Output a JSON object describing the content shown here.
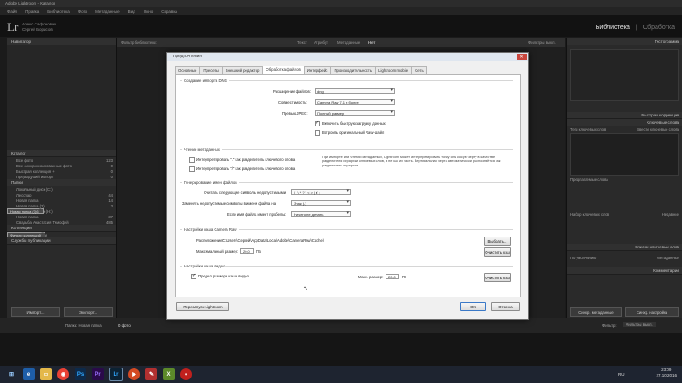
{
  "window": {
    "title": "Adobe Lightroom - Каталог"
  },
  "menu": [
    "Файл",
    "Правка",
    "Библиотека",
    "Фото",
    "Метаданные",
    "Вид",
    "Окно",
    "Справка"
  ],
  "identity": {
    "logo": "Lr",
    "line1": "Алекс Сафонович",
    "line2": "Сергей Борисов"
  },
  "modules": {
    "library": "Библиотека",
    "sep": "|",
    "develop": "Обработка"
  },
  "left_panel": {
    "navigator": "Навигатор",
    "catalog": "Каталог",
    "catalog_items": [
      {
        "label": "Все фото",
        "count": "123"
      },
      {
        "label": "Все синхронизированные фото",
        "count": "0"
      },
      {
        "label": "Быстрая коллекция +",
        "count": "0"
      },
      {
        "label": "Предыдущий импорт",
        "count": "0"
      }
    ],
    "folders": "Папки",
    "folder_items": [
      {
        "label": "Локальный диск (C:)",
        "count": ""
      },
      {
        "label": "Лесопар",
        "count": "44"
      },
      {
        "label": "Новая папка",
        "count": "14"
      },
      {
        "label": "Новая папка (2)",
        "count": "3"
      },
      {
        "label": "Новая папка (3)",
        "count": "6"
      },
      {
        "label": "Локальный диск (H:)",
        "count": ""
      },
      {
        "label": "Новая папка",
        "count": "37"
      },
      {
        "label": "Свадьба Анастасия Тимофей",
        "count": "485"
      }
    ],
    "collections": "Коллекции",
    "collection_items": [
      {
        "label": "Фильтр коллекций"
      },
      {
        "label": "Смарт-коллекции"
      }
    ],
    "publish": "Службы публикации",
    "import_btn": "Импорт...",
    "export_btn": "Экспорт..."
  },
  "right_panel": {
    "histogram": "Гистограмма",
    "quick_develop": "Быстрая коррекция",
    "keywording": "Ключевые слова",
    "keyword_tags": "Теги ключевых слов",
    "keyword_placeholder": "Ввести ключевые слова",
    "keyword_suggestions": "Предлагаемые слова",
    "keyword_set": "Набор ключевых слов",
    "keyword_set_value": "Недавние",
    "keyword_list": "Список ключевых слов",
    "metadata": "Метаданные",
    "metadata_preset": "По умолчанию",
    "comments": "Комментарии",
    "sync": "Синхр. метаданные",
    "sync_settings": "Синхр. настройки"
  },
  "filter_bar": {
    "label": "Фильтр библиотеки:",
    "text": "Текст",
    "attribute": "Атрибут",
    "metadata": "Метаданные",
    "none": "Нет",
    "off": "Фильтры выкл."
  },
  "filmstrip": {
    "path": "Папка: Новая папка",
    "count": "0 фото",
    "filter": "Фильтр:",
    "filter_value": "Фильтры выкл."
  },
  "dialog": {
    "title": "Предпочтения",
    "close": "✕",
    "tabs": [
      "Основные",
      "Пресеты",
      "Внешний редактор",
      "Обработка файлов",
      "Интерфейс",
      "Производительность",
      "Lightroom mobile",
      "Сеть"
    ],
    "active_tab": 3,
    "import_dng": {
      "title": "Создание импорта DNG",
      "ext_label": "Расширение файлов:",
      "ext_value": "dng",
      "compat_label": "Совместимость:",
      "compat_value": "Camera Raw 7.1 и более",
      "jpeg_label": "Превью JPEG:",
      "jpeg_value": "Полный размер",
      "fast_load": "Включить быструю загрузку данных",
      "embed_raw": "Встроить оригинальный Raw-файл"
    },
    "reading_metadata": {
      "title": "Чтение метаданных",
      "opt1": "Интерпретировать \".\" как разделитель ключевого слова",
      "opt2": "Интерпретировать \"/\" как разделитель ключевого слова",
      "note": "При импорте или чтении метаданных, Lightroom может интерпретировать точку или косую черту в качестве разделителя иерархии ключевых слов, а не как их часть. Вертикальная черта автоматически распознаётся как разделитель иерархии."
    },
    "file_naming": {
      "title": "Генерирование имен файлов",
      "illegal_label": "Считать следующие символы недопустимыми:",
      "illegal_value": "/ : \\ * ? \" < > | ¥ ;",
      "replace_label": "Заменять недопустимые символы в имени файла на:",
      "replace_value": "Знак (-)",
      "space_label": "Если имя файла имеет пробелы:",
      "space_value": "Ничего не делать"
    },
    "camera_raw_cache": {
      "title": "Настройки кэша Camera Raw",
      "location_label": "Расположение:",
      "location_value": "C:\\Users\\Сергей\\AppData\\Local\\Adobe\\CameraRaw\\Cache\\",
      "choose": "Выбрать...",
      "max_label": "Максимальный размер:",
      "max_value": "20,0",
      "unit": "ГБ",
      "purge": "Очистить кэш"
    },
    "video_cache": {
      "title": "Настройки кэша видео",
      "limit": "Предел размера кэша видео",
      "max_label": "Макс. размер:",
      "max_value": "20,0",
      "unit": "ГБ",
      "purge": "Очистить кэш"
    },
    "restart": "Перезапуск Lightroom",
    "ok": "ОК",
    "cancel": "Отмена"
  },
  "taskbar": {
    "apps": [
      "start",
      "ie",
      "explorer",
      "chrome",
      "photoshop",
      "premiere",
      "lightroom",
      "media",
      "tool",
      "app",
      "record"
    ],
    "lang": "RU",
    "time": "23:09",
    "date": "27.10.2016"
  },
  "colors": {
    "chrome_red": "#e94235",
    "ps_blue": "#31a8ff",
    "pr_purple": "#9a70ff",
    "lr_blue": "#31a8ff"
  }
}
